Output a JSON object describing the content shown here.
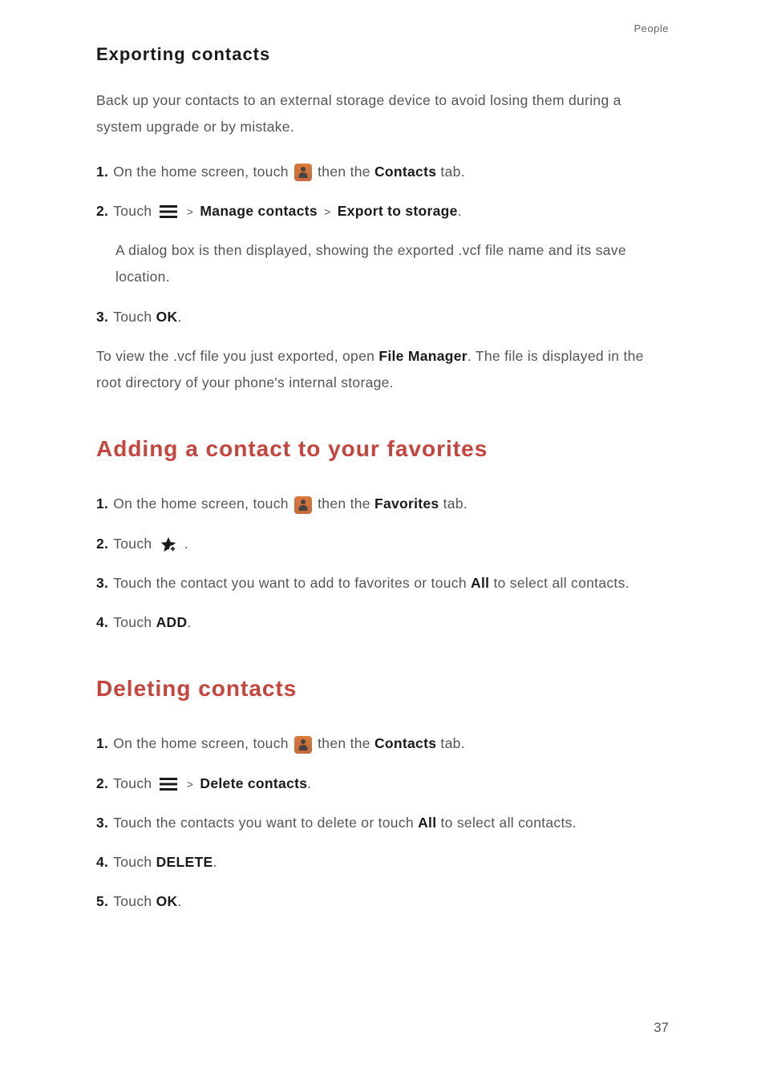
{
  "header": {
    "chapter": "People"
  },
  "exporting": {
    "heading": "Exporting contacts",
    "intro": "Back up your contacts to an external storage device to avoid losing them during a system upgrade or by mistake.",
    "step1_num": "1.",
    "step1_a": "On the home screen, touch ",
    "step1_b": "then the ",
    "step1_bold": "Contacts",
    "step1_c": " tab.",
    "step2_num": "2.",
    "step2_a": "Touch ",
    "step2_gt1": ">",
    "step2_bold1": "Manage contacts",
    "step2_gt2": ">",
    "step2_bold2": "Export to storage",
    "step2_period": ".",
    "step2_detail": "A dialog box is then displayed, showing the exported .vcf file name and its save location.",
    "step3_num": "3.",
    "step3_a": "Touch ",
    "step3_bold": "OK",
    "step3_period": ".",
    "post_a": "To view the .vcf file you just exported, open ",
    "post_bold": "File Manager",
    "post_b": ". The file is displayed in the root directory of your phone's internal storage."
  },
  "adding": {
    "heading": "Adding a contact to your favorites",
    "step1_num": "1.",
    "step1_a": "On the home screen, touch ",
    "step1_b": "then the ",
    "step1_bold": "Favorites",
    "step1_c": " tab.",
    "step2_num": "2.",
    "step2_a": "Touch ",
    "step2_period": ".",
    "step3_num": "3.",
    "step3_a": "Touch the contact you want to add to favorites or touch ",
    "step3_bold": "All",
    "step3_b": " to select all contacts.",
    "step4_num": "4.",
    "step4_a": "Touch ",
    "step4_bold": "ADD",
    "step4_period": "."
  },
  "deleting": {
    "heading": "Deleting contacts",
    "step1_num": "1.",
    "step1_a": "On the home screen, touch ",
    "step1_b": "then the ",
    "step1_bold": "Contacts",
    "step1_c": " tab.",
    "step2_num": "2.",
    "step2_a": "Touch ",
    "step2_gt": ">",
    "step2_bold": "Delete contacts",
    "step2_period": ".",
    "step3_num": "3.",
    "step3_a": "Touch the contacts you want to delete or touch ",
    "step3_bold": "All",
    "step3_b": " to select all contacts.",
    "step4_num": "4.",
    "step4_a": "Touch ",
    "step4_bold": "DELETE",
    "step4_period": ".",
    "step5_num": "5.",
    "step5_a": "Touch ",
    "step5_bold": "OK",
    "step5_period": "."
  },
  "page_number": "37"
}
